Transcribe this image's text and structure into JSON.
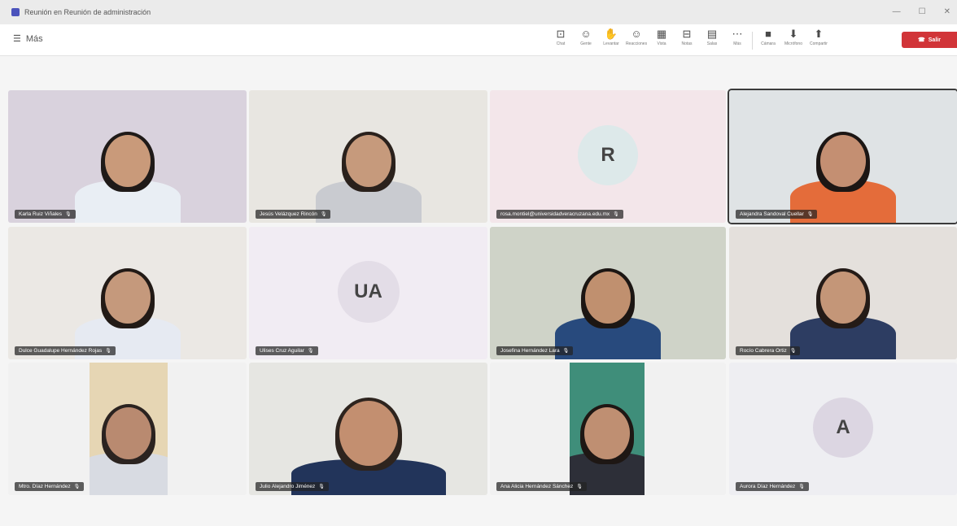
{
  "window": {
    "title": "Reunión en Reunión de administración"
  },
  "header": {
    "more_label": "Más"
  },
  "toolbar": [
    {
      "glyph": "⊡",
      "label": "Chat",
      "icon": "chat-icon"
    },
    {
      "glyph": "☺",
      "label": "Gente",
      "icon": "people-icon"
    },
    {
      "glyph": "✋",
      "label": "Levantar",
      "icon": "raise-hand-icon"
    },
    {
      "glyph": "☺",
      "label": "Reacciones",
      "icon": "reactions-icon"
    },
    {
      "glyph": "▦",
      "label": "Vista",
      "icon": "view-icon"
    },
    {
      "glyph": "⊟",
      "label": "Notas",
      "icon": "notes-icon"
    },
    {
      "glyph": "▤",
      "label": "Salas",
      "icon": "rooms-icon"
    },
    {
      "glyph": "⋯",
      "label": "Más",
      "icon": "more-icon"
    },
    {
      "glyph": "■",
      "label": "Cámara",
      "icon": "camera-icon"
    },
    {
      "glyph": "⬇",
      "label": "Micrófono",
      "icon": "mic-icon"
    },
    {
      "glyph": "⬆",
      "label": "Compartir",
      "icon": "share-icon"
    }
  ],
  "leave": {
    "label": "Salir"
  },
  "participants": [
    {
      "name": "Karla Ruiz Viñales",
      "initials": "",
      "bg": "#d9d2dd"
    },
    {
      "name": "Jesús Velázquez Rincón",
      "initials": "",
      "bg": "#e8e6e1"
    },
    {
      "name": "rosa.montiel@universidadveracruzana.edu.mx",
      "initials": "R",
      "bg": "#f3e6ea"
    },
    {
      "name": "Alejandra Sandoval Cuellar",
      "initials": "",
      "bg": "#dfe3e5"
    },
    {
      "name": "Dulce Guadalupe Hernández Rojas",
      "initials": "",
      "bg": "#ebe8e4"
    },
    {
      "name": "Ulises Cruz Aguilar",
      "initials": "UA",
      "bg": "#f1ecf3"
    },
    {
      "name": "Josefina Hernández Lara",
      "initials": "",
      "bg": "#cfd3c8"
    },
    {
      "name": "Rocío Cabrera Ortiz",
      "initials": "",
      "bg": "#e4e0dc"
    },
    {
      "name": "Mtro. Díaz Hernández",
      "initials": "",
      "bg": "#f1f1f1"
    },
    {
      "name": "Julio Alejandro Jiménez",
      "initials": "",
      "bg": "#e6e6e2"
    },
    {
      "name": "Ana Alicia Hernández Sánchez",
      "initials": "",
      "bg": "#f1f1f1"
    },
    {
      "name": "Aurora Díaz Hernández",
      "initials": "A",
      "bg": "#eeeef2"
    }
  ]
}
